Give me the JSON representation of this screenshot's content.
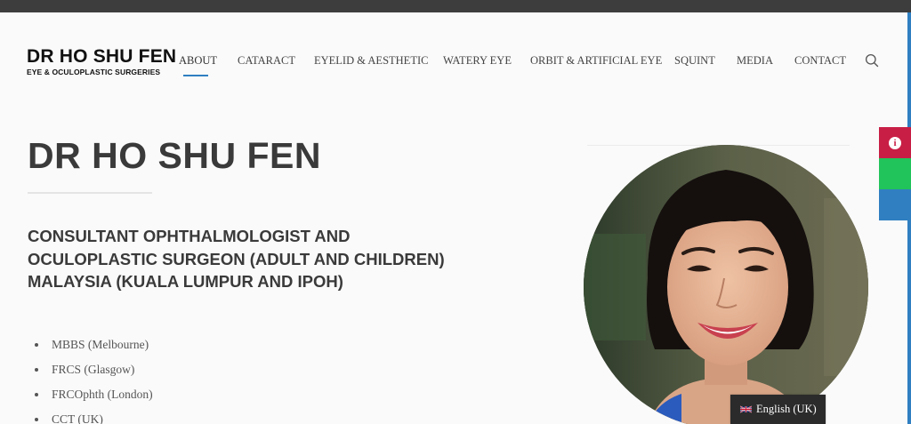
{
  "brand": {
    "title": "DR HO SHU FEN",
    "subtitle": "EYE & OCULOPLASTIC SURGERIES"
  },
  "nav": {
    "items": [
      {
        "label": "ABOUT",
        "active": true
      },
      {
        "label": "CATARACT"
      },
      {
        "label": "EYELID & AESTHETIC"
      },
      {
        "label": "WATERY EYE"
      },
      {
        "label": "ORBIT & ARTIFICIAL EYE"
      },
      {
        "label": "SQUINT"
      },
      {
        "label": "MEDIA"
      },
      {
        "label": "CONTACT"
      }
    ],
    "search_icon": "search-icon",
    "accent": "#2f7fc1"
  },
  "main": {
    "title": "DR HO SHU FEN",
    "subtitle": "CONSULTANT OPHTHALMOLOGIST AND OCULOPLASTIC SURGEON (ADULT AND CHILDREN) MALAYSIA (KUALA LUMPUR AND IPOH)",
    "qualifications": [
      "MBBS (Melbourne)",
      "FRCS (Glasgow)",
      "FRCOphth (London)",
      "CCT (UK)"
    ]
  },
  "side_tabs": [
    {
      "icon": "info-icon",
      "color": "#c81e45"
    },
    {
      "icon": "",
      "color": "#21c45a"
    },
    {
      "icon": "",
      "color": "#2f7fc1"
    }
  ],
  "language": {
    "flag": "uk-flag-icon",
    "label": "English (UK)"
  }
}
